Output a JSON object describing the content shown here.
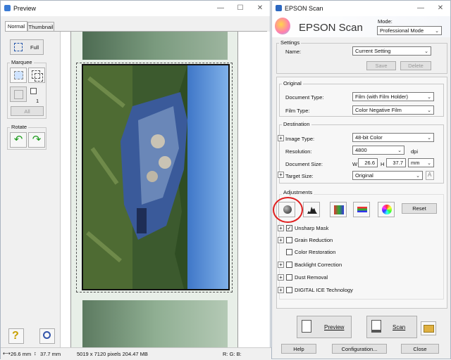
{
  "preview_window": {
    "title": "Preview",
    "tabs": [
      "Normal",
      "Thumbnail"
    ],
    "full_label": "Full",
    "marquee_label": "Marquee",
    "marquee_count": "1",
    "all_label": "All",
    "rotate_label": "Rotate",
    "status": {
      "width": "26.6 mm",
      "height": "37.7 mm",
      "pixels": "5019 x 7120 pixels 204.47 MB",
      "rgb": "R: G: B:"
    }
  },
  "scan_window": {
    "title": "EPSON Scan",
    "brand": "EPSON Scan",
    "mode_label": "Mode:",
    "mode_value": "Professional Mode",
    "settings": {
      "group_label": "Settings",
      "name_label": "Name:",
      "name_value": "Current Setting",
      "save_label": "Save",
      "delete_label": "Delete"
    },
    "original": {
      "group_label": "Original",
      "document_type_label": "Document Type:",
      "document_type_value": "Film (with Film Holder)",
      "film_type_label": "Film Type:",
      "film_type_value": "Color Negative Film"
    },
    "destination": {
      "group_label": "Destination",
      "image_type_label": "Image Type:",
      "image_type_value": "48-bit Color",
      "resolution_label": "Resolution:",
      "resolution_value": "4800",
      "resolution_unit": "dpi",
      "document_size_label": "Document Size:",
      "w_label": "W",
      "w_value": "26.6",
      "h_label": "H",
      "h_value": "37.7",
      "size_unit": "mm",
      "target_size_label": "Target Size:",
      "target_size_value": "Original"
    },
    "adjustments": {
      "group_label": "Adjustments",
      "reset_label": "Reset",
      "options": [
        {
          "label": "Unsharp Mask",
          "checked": true
        },
        {
          "label": "Grain Reduction",
          "checked": false
        },
        {
          "label": "Color Restoration",
          "checked": false
        },
        {
          "label": "Backlight Correction",
          "checked": false
        },
        {
          "label": "Dust Removal",
          "checked": false
        },
        {
          "label": "DIGITAL ICE Technology",
          "checked": false
        }
      ]
    },
    "preview_label": "Preview",
    "scan_label": "Scan",
    "help_label": "Help",
    "configuration_label": "Configuration...",
    "close_label": "Close"
  },
  "colors": {
    "highlight_circle": "#e02020",
    "epson_blue": "#1a4fa0"
  }
}
